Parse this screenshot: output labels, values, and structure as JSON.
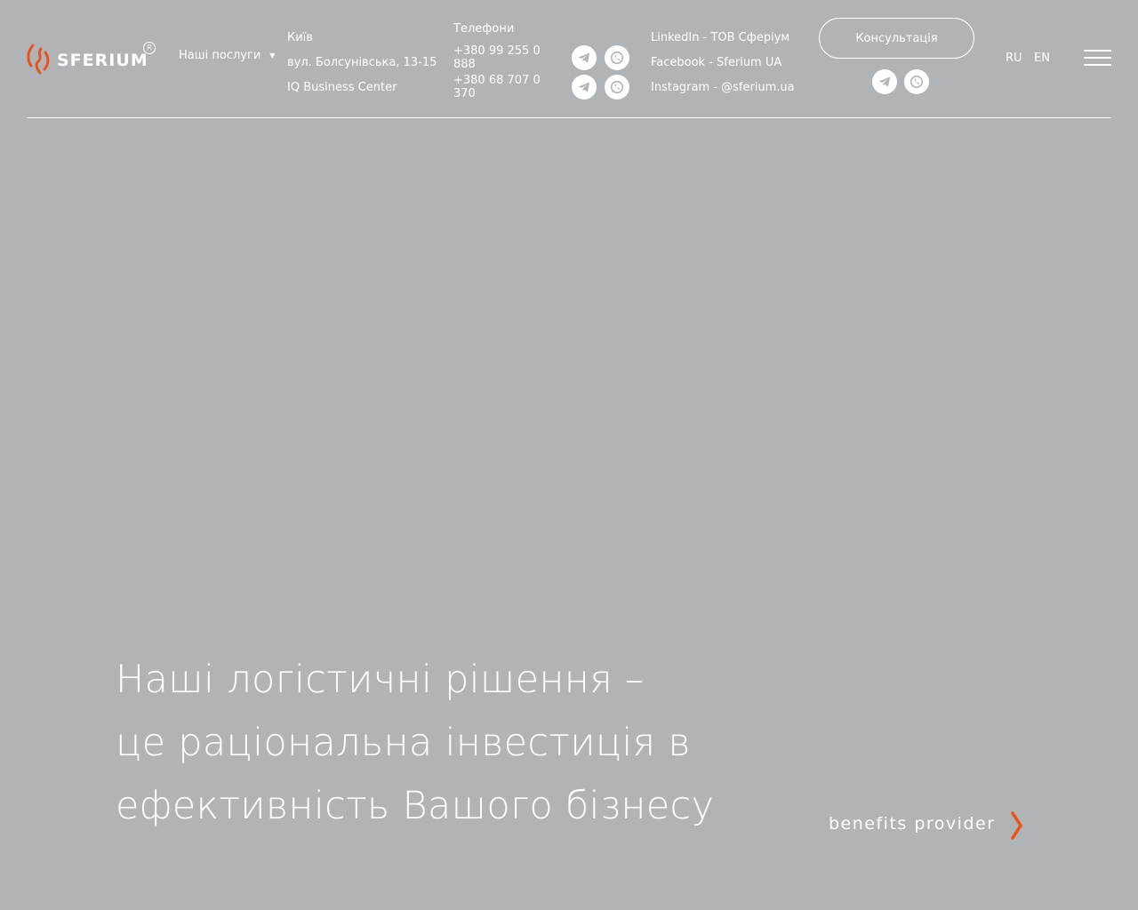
{
  "brand": {
    "name": "SFERIUM",
    "reg_mark": "R",
    "accent": "#e8531e"
  },
  "nav": {
    "services_label": "Наші послуги"
  },
  "address": {
    "city": "Київ",
    "street": "вул. Болсунівська, 13-15",
    "building": "IQ Business Center"
  },
  "phones": {
    "title": "Телефони",
    "items": [
      "+380 99 255 0 888",
      "+380 68 707 0 370"
    ]
  },
  "social": {
    "linkedin": "LinkedIn - ТОВ Сферіум",
    "facebook": "Facebook - Sferium UA",
    "instagram": "Instagram - @sferium.ua"
  },
  "consult": {
    "label": "Консультація"
  },
  "languages": [
    "RU",
    "EN"
  ],
  "icons": {
    "messenger_1": "telegram-icon",
    "messenger_2": "whatsapp-icon",
    "menu": "hamburger-menu-icon"
  },
  "hero": {
    "lines": [
      "Наші логістичні рішення –",
      "це раціональна інвестиція в",
      "ефективність Вашого бізнесу"
    ],
    "benefits": "benefits provider"
  },
  "colors": {
    "background": "#b1b4b7",
    "text": "#ffffff",
    "icon_fill": "#b1b4b7"
  }
}
